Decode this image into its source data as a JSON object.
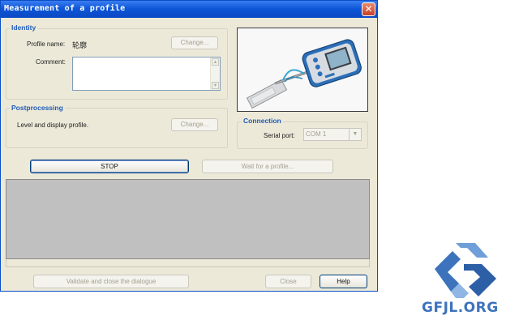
{
  "window": {
    "title": "Measurement of a profile",
    "close_icon": "close-icon"
  },
  "identity": {
    "group_title": "Identity",
    "profile_name_label": "Profile name:",
    "profile_name_value": "轮廓",
    "change_button": "Change...",
    "comment_label": "Comment:",
    "comment_value": ""
  },
  "postprocessing": {
    "group_title": "Postprocessing",
    "description": "Level and display profile.",
    "change_button": "Change..."
  },
  "connection": {
    "group_title": "Connection",
    "serial_port_label": "Serial port:",
    "serial_port_value": "COM 1"
  },
  "actions": {
    "stop_button": "STOP",
    "wait_button": "Wait for a profile..."
  },
  "footer": {
    "validate_button": "Validate and close the dialogue",
    "close_button": "Close",
    "help_button": "Help"
  },
  "watermark": {
    "text": "GFJL.ORG"
  },
  "colors": {
    "titlebar": "#0e57d8",
    "dialog_bg": "#ece9d8",
    "group_title": "#1f5bb8",
    "output_area": "#c0c0c0",
    "watermark": "#3d73bd"
  }
}
